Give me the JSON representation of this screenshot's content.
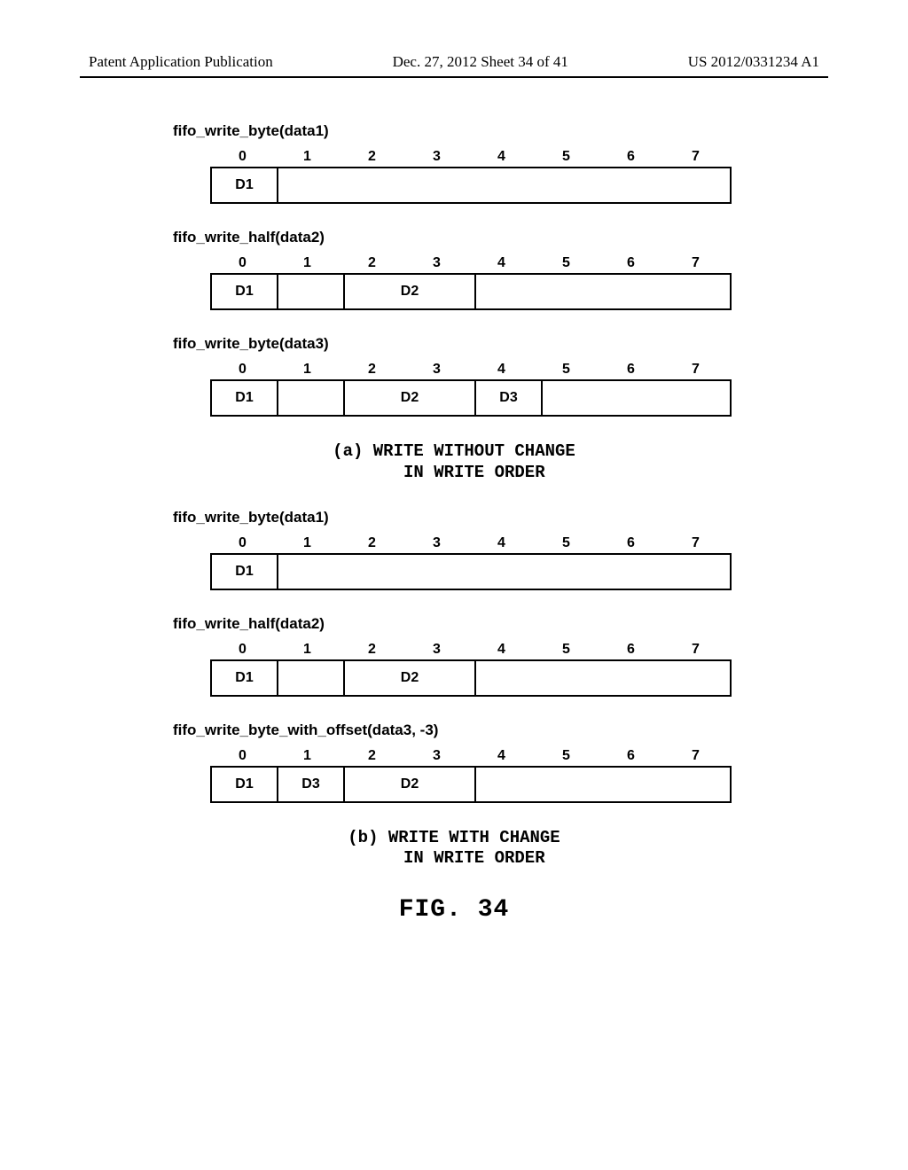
{
  "header": {
    "left": "Patent Application Publication",
    "center": "Dec. 27, 2012  Sheet 34 of 41",
    "right": "US 2012/0331234 A1"
  },
  "indices": [
    "0",
    "1",
    "2",
    "3",
    "4",
    "5",
    "6",
    "7"
  ],
  "groupA": {
    "s1": {
      "fn": "fifo_write_byte(data1)",
      "cells": [
        "D1"
      ]
    },
    "s2": {
      "fn": "fifo_write_half(data2)",
      "cells": [
        "D1",
        "",
        "D2"
      ]
    },
    "s3": {
      "fn": "fifo_write_byte(data3)",
      "cells": [
        "D1",
        "",
        "D2",
        "D3"
      ]
    },
    "caption": "(a) WRITE WITHOUT CHANGE\n    IN WRITE ORDER"
  },
  "groupB": {
    "s1": {
      "fn": "fifo_write_byte(data1)",
      "cells": [
        "D1"
      ]
    },
    "s2": {
      "fn": "fifo_write_half(data2)",
      "cells": [
        "D1",
        "",
        "D2"
      ]
    },
    "s3": {
      "fn": "fifo_write_byte_with_offset(data3, -3)",
      "cells_b": [
        "D1",
        "D3",
        "D2"
      ]
    },
    "caption": "(b) WRITE WITH CHANGE\n    IN WRITE ORDER"
  },
  "figure": "FIG. 34"
}
